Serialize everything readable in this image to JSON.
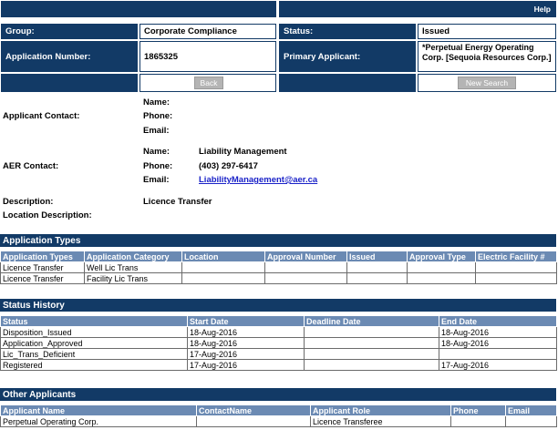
{
  "header": {
    "help_label": "Help"
  },
  "info": {
    "group_label": "Group:",
    "group_value": "Corporate Compliance",
    "status_label": "Status:",
    "status_value": "Issued",
    "app_number_label": "Application Number:",
    "app_number_value": "1865325",
    "primary_applicant_label": "Primary Applicant:",
    "primary_applicant_value": "*Perpetual Energy Operating Corp. [Sequoia Resources Corp.]"
  },
  "buttons": {
    "back": "Back",
    "new_search": "New Search"
  },
  "contacts": {
    "applicant_contact_label": "Applicant Contact:",
    "aer_contact_label": "AER Contact:",
    "name_label": "Name:",
    "phone_label": "Phone:",
    "email_label": "Email:",
    "aer_name": "Liability Management",
    "aer_phone": "(403) 297-6417",
    "aer_email": "LiabilityManagement@aer.ca"
  },
  "details": {
    "description_label": "Description:",
    "description_value": "Licence Transfer",
    "location_label": "Location Description:"
  },
  "application_types": {
    "title": "Application Types",
    "columns": [
      "Application Types",
      "Application Category",
      "Location",
      "Approval Number",
      "Issued",
      "Approval Type",
      "Electric Facility #"
    ],
    "rows": [
      [
        "Licence Transfer",
        "Well Lic Trans",
        "",
        "",
        "",
        "",
        ""
      ],
      [
        "Licence Transfer",
        "Facility Lic Trans",
        "",
        "",
        "",
        "",
        ""
      ]
    ]
  },
  "status_history": {
    "title": "Status History",
    "columns": [
      "Status",
      "Start Date",
      "Deadline Date",
      "End Date"
    ],
    "rows": [
      [
        "Disposition_Issued",
        "18-Aug-2016",
        "",
        "18-Aug-2016"
      ],
      [
        "Application_Approved",
        "18-Aug-2016",
        "",
        "18-Aug-2016"
      ],
      [
        "Lic_Trans_Deficient",
        "17-Aug-2016",
        "",
        ""
      ],
      [
        "Registered",
        "17-Aug-2016",
        "",
        "17-Aug-2016"
      ]
    ]
  },
  "other_applicants": {
    "title": "Other Applicants",
    "columns": [
      "Applicant Name",
      "ContactName",
      "Applicant Role",
      "Phone",
      "Email"
    ],
    "rows": [
      [
        "Perpetual Operating Corp.",
        "",
        "Licence Transferee",
        "",
        ""
      ]
    ]
  }
}
